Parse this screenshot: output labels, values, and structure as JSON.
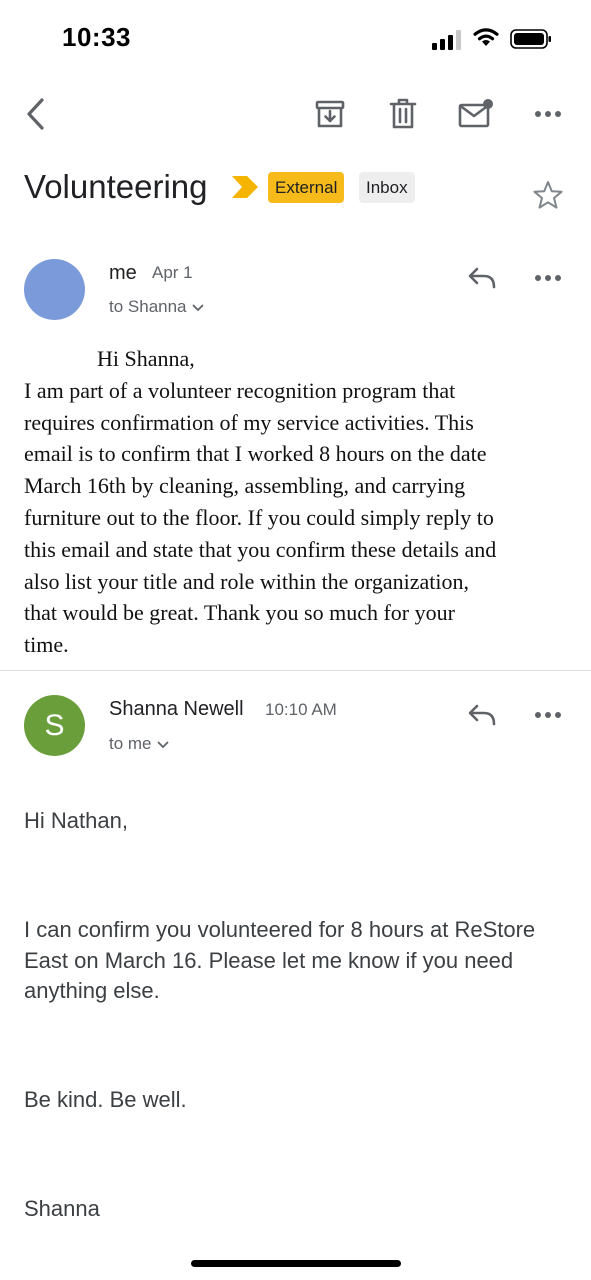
{
  "status_bar": {
    "time": "10:33"
  },
  "toolbar": {
    "back_icon": "chevron-left-icon",
    "archive_icon": "archive-icon",
    "delete_icon": "trash-icon",
    "mark_unread_icon": "mail-unread-icon",
    "more_icon": "more-horizontal-icon"
  },
  "thread": {
    "subject": "Volunteering",
    "labels": [
      "External",
      "Inbox"
    ],
    "colors": {
      "external": "#f6bb1b",
      "importance": "#f5b400",
      "avatar_me": "#7b9ad9",
      "avatar_shanna": "#6a9e3b"
    }
  },
  "messages": [
    {
      "sender": "me",
      "date": "Apr 1",
      "recipient": "to Shanna",
      "body": {
        "greeting": "Hi Shanna,",
        "lines": [
          "I am part of a volunteer recognition program that",
          "requires confirmation of my service activities. This",
          "email is to confirm that I worked 8 hours on the date",
          "March 16th by cleaning, assembling, and carrying",
          "furniture out to the floor. If you could simply reply to",
          "this email and state that you confirm these details and",
          "also list your title and role within the organization,",
          "that would be great. Thank you so much for your",
          "time."
        ]
      }
    },
    {
      "sender": "Shanna Newell",
      "avatar_letter": "S",
      "date": "10:10 AM",
      "recipient": "to me",
      "body": {
        "greeting": "Hi Nathan,",
        "paragraph": "I can confirm you volunteered for 8 hours at ReStore East on March 16. Please let me know if you need anything else.",
        "closing": "Be kind. Be well.",
        "signature": "Shanna"
      }
    }
  ]
}
